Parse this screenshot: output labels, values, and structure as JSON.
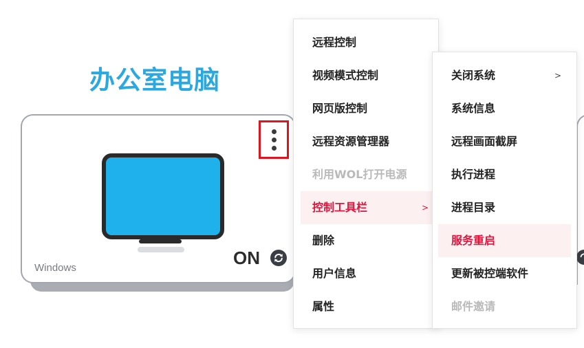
{
  "device": {
    "title": "办公室电脑",
    "os": "Windows",
    "status": "ON",
    "screen_color": "#1fb1ec",
    "title_color": "#29a9df"
  },
  "context_menu": {
    "items": [
      {
        "label": "远程控制",
        "state": "normal"
      },
      {
        "label": "视频模式控制",
        "state": "normal"
      },
      {
        "label": "网页版控制",
        "state": "normal"
      },
      {
        "label": "远程资源管理器",
        "state": "normal"
      },
      {
        "label": "利用WOL打开电源",
        "state": "disabled"
      },
      {
        "label": "控制工具栏",
        "state": "active",
        "arrow": ">"
      },
      {
        "label": "删除",
        "state": "normal"
      },
      {
        "label": "用户信息",
        "state": "normal"
      },
      {
        "label": "属性",
        "state": "normal"
      }
    ]
  },
  "submenu": {
    "items": [
      {
        "label": "关闭系统",
        "state": "normal",
        "arrow": ">"
      },
      {
        "label": "系统信息",
        "state": "normal"
      },
      {
        "label": "远程画面截屏",
        "state": "normal"
      },
      {
        "label": "执行进程",
        "state": "normal"
      },
      {
        "label": "进程目录",
        "state": "normal"
      },
      {
        "label": "服务重启",
        "state": "active"
      },
      {
        "label": "更新被控端软件",
        "state": "normal"
      },
      {
        "label": "邮件邀请",
        "state": "disabled"
      }
    ]
  },
  "colors": {
    "accent_red": "#e0143c",
    "highlight_border": "#e0141e",
    "disabled_text": "#b9b9b9"
  },
  "icons": {
    "more": "more-vertical-icon",
    "refresh": "refresh-icon",
    "monitor": "monitor-icon"
  }
}
